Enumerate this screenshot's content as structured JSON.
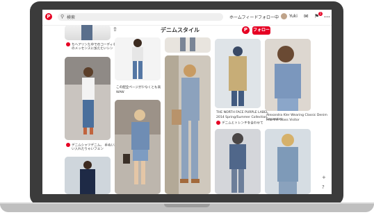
{
  "app": {
    "accent": "#e60023"
  },
  "nav": {
    "logo": "P",
    "search_icon": "search-icon",
    "search_text": "検索",
    "home_label": "ホームフィード",
    "following_label": "フォロー中",
    "user_name": "Yuki",
    "notification_count": "1",
    "more_glyph": "•••"
  },
  "board": {
    "title": "デニムスタイル",
    "logo": "P",
    "follow_label": "フォロー"
  },
  "captions": {
    "col1_top_a": "ちヘアリンた中でのコーディネー",
    "col1_top_b": "のメッセンスに加えたいシン",
    "col1_mid_a": "デニムシャツデニム。 手ぬいおう",
    "col1_mid_b": "い入れたりゃいフエン",
    "col2_a": "この配全ページが少なくとも高",
    "col2_b": "WAW",
    "col4_a": "THE NORTH FACE PURPLE LABEL",
    "col4_b": "2014 Spring/Summer Collection",
    "col4_c": "デニムとトレンチを合わせて",
    "col5_a": "Alexandra Kler Wearing Classic Denim Separates",
    "col5_b": "Into the Glass Visitor"
  },
  "side": {
    "add": "+",
    "help": "?"
  }
}
